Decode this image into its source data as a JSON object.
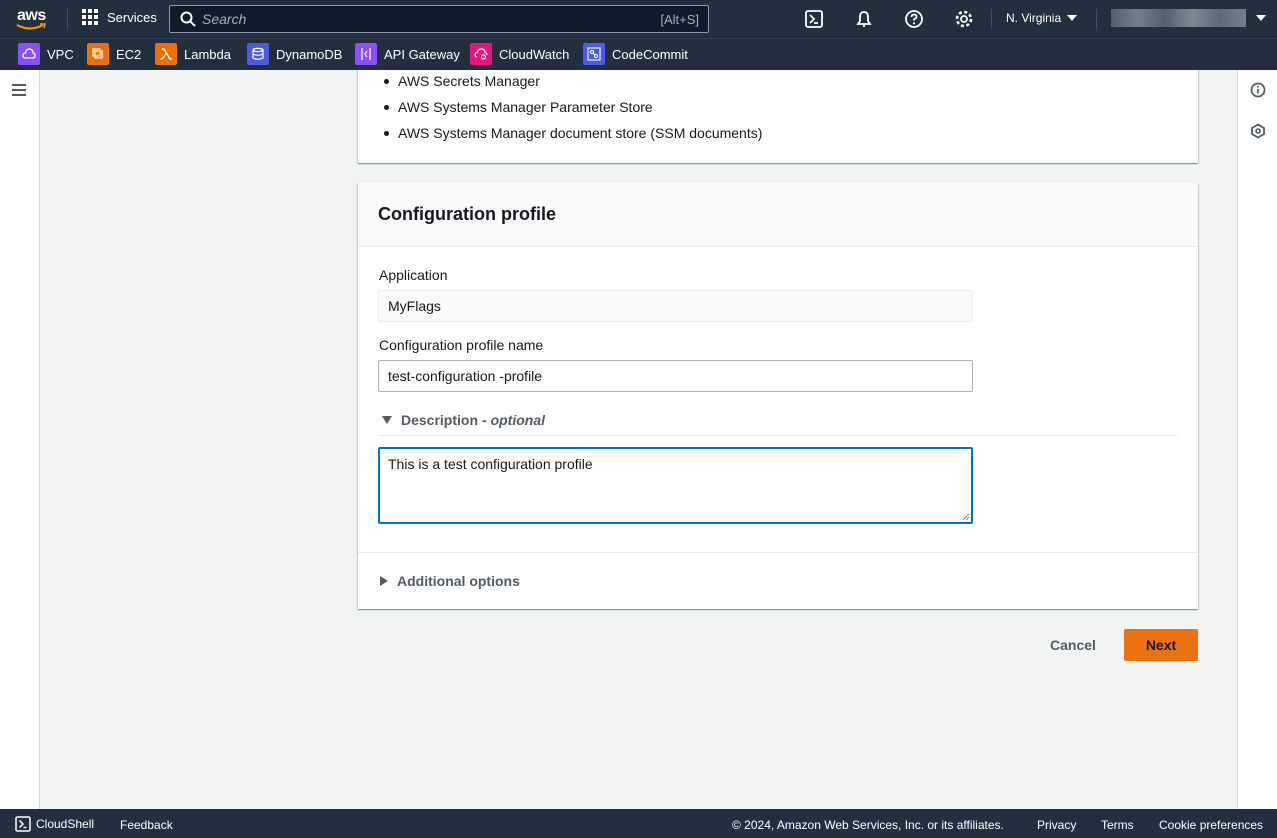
{
  "topnav": {
    "logo": "aws",
    "services_label": "Services",
    "search_placeholder": "Search",
    "search_shortcut": "[Alt+S]",
    "region": "N. Virginia"
  },
  "favorites": [
    {
      "label": "VPC",
      "color": "#8c4fff"
    },
    {
      "label": "EC2",
      "color": "#ed7100"
    },
    {
      "label": "Lambda",
      "color": "#ed7100"
    },
    {
      "label": "DynamoDB",
      "color": "#4d5ae3"
    },
    {
      "label": "API Gateway",
      "color": "#8c4fff"
    },
    {
      "label": "CloudWatch",
      "color": "#e7157b"
    },
    {
      "label": "CodeCommit",
      "color": "#4d5ae3"
    }
  ],
  "source_list": {
    "items": [
      "AWS Secrets Manager",
      "AWS Systems Manager Parameter Store",
      "AWS Systems Manager document store (SSM documents)"
    ]
  },
  "config_profile": {
    "title": "Configuration profile",
    "application_label": "Application",
    "application_value": "MyFlags",
    "name_label": "Configuration profile name",
    "name_value": "test-configuration -profile",
    "description_label": "Description",
    "description_optional": "- optional",
    "description_value": "This is a test configuration profile",
    "additional_options_label": "Additional options"
  },
  "actions": {
    "cancel_label": "Cancel",
    "next_label": "Next"
  },
  "footer": {
    "cloudshell_label": "CloudShell",
    "feedback_label": "Feedback",
    "copyright": "© 2024, Amazon Web Services, Inc. or its affiliates.",
    "privacy": "Privacy",
    "terms": "Terms",
    "cookie_preferences": "Cookie preferences"
  },
  "colors": {
    "nav_bg": "#232f3e",
    "primary_button": "#ec7211",
    "focus_border": "#0073bb"
  }
}
